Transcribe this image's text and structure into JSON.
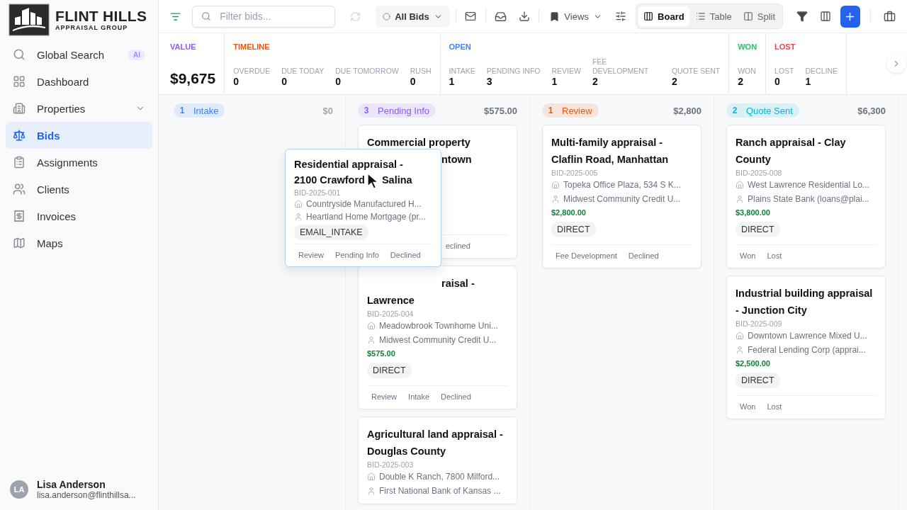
{
  "brand": {
    "name": "FLINT HILLS",
    "tagline": "APPRAISAL GROUP"
  },
  "sidebar": {
    "items": [
      {
        "label": "Global Search",
        "badge": "AI",
        "selected": false
      },
      {
        "label": "Dashboard",
        "selected": false
      },
      {
        "label": "Properties",
        "expanded": false,
        "selected": false
      },
      {
        "label": "Bids",
        "selected": true
      },
      {
        "label": "Assignments",
        "selected": false
      },
      {
        "label": "Clients",
        "selected": false
      },
      {
        "label": "Invoices",
        "selected": false
      },
      {
        "label": "Maps",
        "selected": false
      }
    ],
    "user": {
      "initials": "LA",
      "name": "Lisa Anderson",
      "email": "lisa.anderson@flinthillsa..."
    }
  },
  "toolbar": {
    "search": {
      "placeholder": "Filter bids..."
    },
    "refresh": {
      "disabled": true
    },
    "scope": {
      "label": "All Bids"
    },
    "views": {
      "label": "Views"
    },
    "view_modes": [
      {
        "label": "Board",
        "selected": true
      },
      {
        "label": "Table",
        "selected": false
      },
      {
        "label": "Split",
        "selected": false
      }
    ]
  },
  "stats": [
    {
      "title": "VALUE",
      "color": "#8b5cf6",
      "kind": "total",
      "value": "$9,675"
    },
    {
      "title": "TIMELINE",
      "color": "#ea580c",
      "kind": "counts",
      "items": [
        {
          "label": "OVERDUE",
          "value": "0"
        },
        {
          "label": "DUE TODAY",
          "value": "0"
        },
        {
          "label": "DUE TOMORROW",
          "value": "0"
        },
        {
          "label": "RUSH",
          "value": "0"
        }
      ]
    },
    {
      "title": "OPEN",
      "color": "#3b82f6",
      "kind": "counts",
      "items": [
        {
          "label": "INTAKE",
          "value": "1"
        },
        {
          "label": "PENDING INFO",
          "value": "3"
        },
        {
          "label": "REVIEW",
          "value": "1"
        },
        {
          "label": "FEE DEVELOPMENT",
          "value": "2"
        },
        {
          "label": "QUOTE SENT",
          "value": "2"
        }
      ]
    },
    {
      "title": "WON",
      "color": "#22c55e",
      "kind": "counts",
      "items": [
        {
          "label": "WON",
          "value": "2"
        }
      ]
    },
    {
      "title": "LOST",
      "color": "#ef4444",
      "kind": "counts",
      "items": [
        {
          "label": "LOST",
          "value": "0"
        },
        {
          "label": "DECLINE",
          "value": "1"
        }
      ]
    }
  ],
  "board": {
    "columns": [
      {
        "name": "Intake",
        "count": "1",
        "total": "$0",
        "color": "#3b82f6",
        "faded": true
      },
      {
        "name": "Pending Info",
        "count": "3",
        "total": "$575.00",
        "color": "#8b5cf6",
        "faded": false,
        "cards": [
          {
            "kind": "covered",
            "title": "Commercial property",
            "title_tail": "ntown",
            "actions_tail": "eclined"
          },
          {
            "kind": "partly_covered",
            "title_tail": "raisal -",
            "title": "Lawrence",
            "id": "BID-2025-004",
            "property": "Meadowbrook Townhome Uni...",
            "client": "Midwest Community Credit U...",
            "amount": "$575.00",
            "tag": "DIRECT",
            "actions": [
              "Review",
              "Intake",
              "Declined"
            ]
          },
          {
            "kind": "full",
            "title": "Agricultural land appraisal - Douglas County",
            "id": "BID-2025-003",
            "property": "Double K Ranch, 7800 Milford...",
            "client": "First National Bank of Kansas ..."
          }
        ]
      },
      {
        "name": "Review",
        "count": "1",
        "total": "$2,800",
        "color": "#ea580c",
        "faded": false,
        "cards": [
          {
            "kind": "full",
            "title": "Multi-family appraisal - Claflin Road, Manhattan",
            "id": "BID-2025-005",
            "property": "Topeka Office Plaza, 534 S K...",
            "client": "Midwest Community Credit U...",
            "amount": "$2,800.00",
            "tag": "DIRECT",
            "actions": [
              "Fee Development",
              "Declined"
            ]
          }
        ]
      },
      {
        "name": "Quote Sent",
        "count": "2",
        "total": "$6,300",
        "color": "#06b6d4",
        "faded": false,
        "cards": [
          {
            "kind": "full",
            "title": "Ranch appraisal - Clay County",
            "id": "BID-2025-008",
            "property": "West Lawrence Residential Lo...",
            "client": "Plains State Bank (loans@plai...",
            "amount": "$3,800.00",
            "tag": "DIRECT",
            "actions": [
              "Won",
              "Lost"
            ]
          },
          {
            "kind": "full",
            "title": "Industrial building appraisal - Junction City",
            "id": "BID-2025-009",
            "property": "Downtown Lawrence Mixed U...",
            "client": "Federal Lending Corp (apprai...",
            "amount": "$2,500.00",
            "tag": "DIRECT",
            "actions": [
              "Won",
              "Lost"
            ]
          }
        ]
      }
    ],
    "dragged_card": {
      "title": "Residential appraisal -",
      "title_line2": "2100 Crawford",
      "title_end": "Salina",
      "id": "BID-2025-001",
      "property": "Countryside Manufactured H...",
      "client": "Heartland Home Mortgage (pr...",
      "tag": "EMAIL_INTAKE",
      "actions": [
        "Review",
        "Pending Info",
        "Declined"
      ]
    }
  }
}
